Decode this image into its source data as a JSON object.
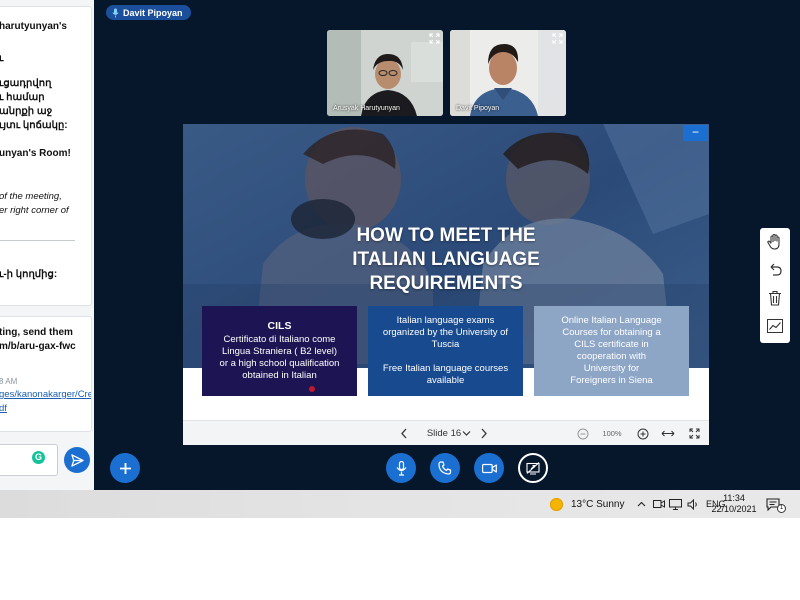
{
  "chat": {
    "lines": [
      "harutyunyan's",
      "ւ",
      "ւցադրվող",
      "ւ համար",
      "անրքի աջ",
      "ւյտւ կոճակը:",
      "unyan's Room!",
      "of the meeting,",
      "er right corner of",
      "ւ-ի կողմից:",
      "ting, send them",
      "m/b/aru-gax-fwc"
    ],
    "time": "8 AM",
    "link_lines": [
      "ges/kanonakarger/Cre",
      "df"
    ],
    "grammarly_badge": "G"
  },
  "presenter": {
    "name": "Davit Pipoyan"
  },
  "participants": [
    {
      "name": "Arusyak Harutyunyan"
    },
    {
      "name": "Davit Pipoyan"
    }
  ],
  "slide": {
    "title_lines": [
      "HOW TO MEET THE",
      "ITALIAN LANGUAGE",
      "REQUIREMENTS"
    ],
    "box1": {
      "title": "CILS",
      "lines": [
        "Certificato di Italiano come",
        "Lingua Straniera  ( B2 level)",
        "or a high school qualification",
        "obtained in Italian"
      ]
    },
    "box2": {
      "lines_a": [
        "Italian language exams",
        "organized by the University of",
        "Tuscia"
      ],
      "lines_b": [
        "Free Italian language courses",
        "available"
      ]
    },
    "box3": {
      "lines": [
        "Online Italian Language",
        "Courses for obtaining a",
        "CILS certificate in",
        "cooperation with",
        "University for",
        "Foreigners in Siena"
      ]
    },
    "minimize": "−"
  },
  "slide_toolbar": {
    "slide_label": "Slide 16",
    "zoom": "100%"
  },
  "taskbar": {
    "weather": "13°C  Sunny",
    "language": "ENG",
    "time": "11:34",
    "date": "22/10/2021",
    "notifications": "1"
  },
  "colors": {
    "main_bg": "#06172b",
    "accent_blue": "#1b6fd1",
    "box1": "#1d1453",
    "box2": "#174a8f",
    "box3": "#8ea6c6"
  }
}
